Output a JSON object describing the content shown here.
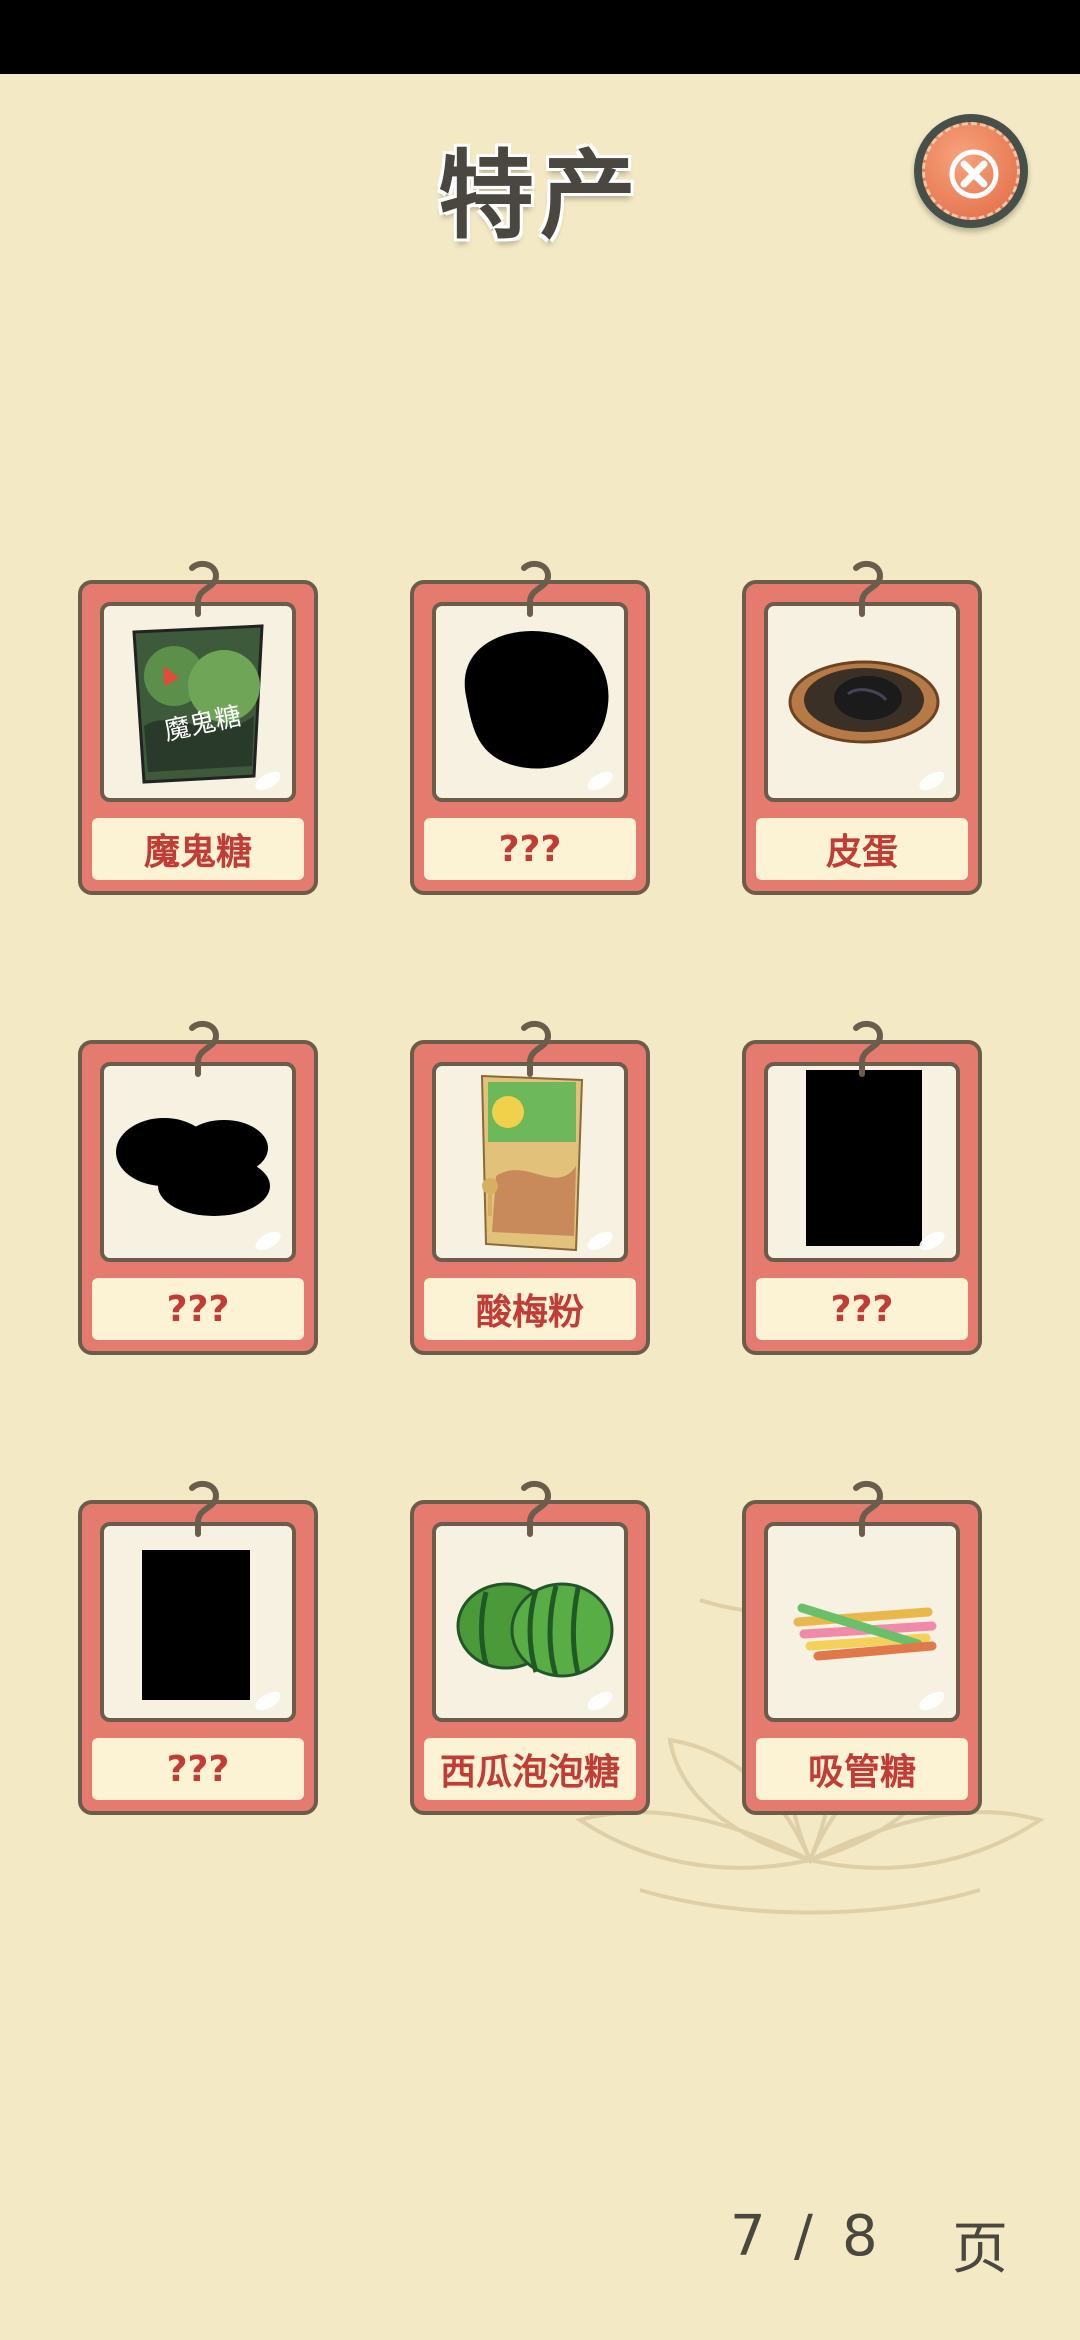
{
  "header": {
    "title": "特产"
  },
  "close_button": {
    "icon": "close-icon"
  },
  "cards": [
    {
      "name": "魔鬼糖",
      "discovered": true,
      "icon": "devil-candy-icon"
    },
    {
      "name": "???",
      "discovered": false,
      "icon": "unknown-silhouette-icon"
    },
    {
      "name": "皮蛋",
      "discovered": true,
      "icon": "century-egg-icon"
    },
    {
      "name": "???",
      "discovered": false,
      "icon": "unknown-silhouette-icon"
    },
    {
      "name": "酸梅粉",
      "discovered": true,
      "icon": "sour-plum-powder-icon"
    },
    {
      "name": "???",
      "discovered": false,
      "icon": "unknown-silhouette-icon"
    },
    {
      "name": "???",
      "discovered": false,
      "icon": "unknown-silhouette-icon"
    },
    {
      "name": "西瓜泡泡糖",
      "discovered": true,
      "icon": "watermelon-gum-icon"
    },
    {
      "name": "吸管糖",
      "discovered": true,
      "icon": "straw-candy-icon"
    }
  ],
  "pagination": {
    "current": "7",
    "separator": "/",
    "total": "8",
    "unit": "页"
  },
  "colors": {
    "background": "#f3e9c4",
    "card_red": "#e57b6e",
    "label_text": "#c23c36",
    "border": "#6a5d4b"
  }
}
